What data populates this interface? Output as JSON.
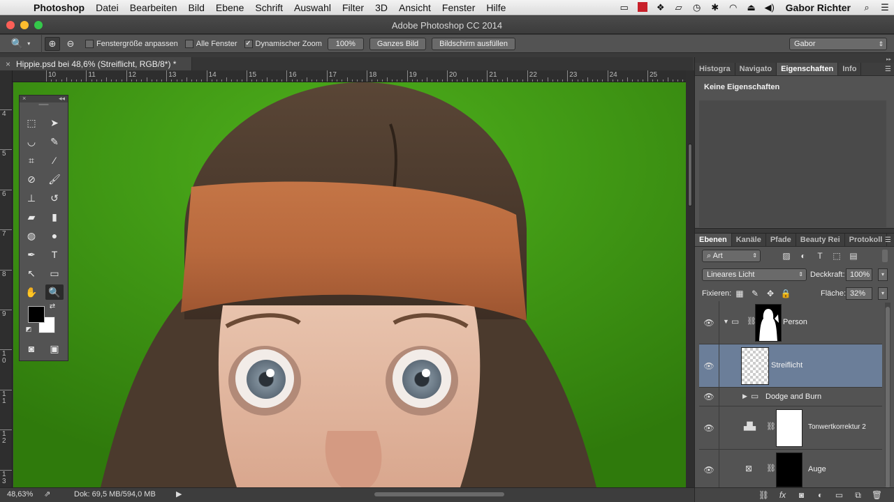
{
  "menubar": {
    "app": "Photoshop",
    "items": [
      "Datei",
      "Bearbeiten",
      "Bild",
      "Ebene",
      "Schrift",
      "Auswahl",
      "Filter",
      "3D",
      "Ansicht",
      "Fenster",
      "Hilfe"
    ],
    "user": "Gabor Richter"
  },
  "window": {
    "title": "Adobe Photoshop CC 2014"
  },
  "options": {
    "fit_window": "Fenstergröße anpassen",
    "all_windows": "Alle Fenster",
    "dynamic_zoom": "Dynamischer Zoom",
    "btn_100": "100%",
    "btn_whole": "Ganzes Bild",
    "btn_fill": "Bildschirm ausfüllen",
    "workspace": "Gabor",
    "fit_window_checked": false,
    "all_windows_checked": false,
    "dynamic_zoom_checked": true
  },
  "document": {
    "tab": "Hippie.psd bei 48,6% (Streiflicht, RGB/8*) *"
  },
  "rulers": {
    "top": [
      "10",
      "11",
      "12",
      "13",
      "14",
      "15",
      "16",
      "17",
      "18",
      "19",
      "20",
      "21",
      "22",
      "23",
      "24",
      "25"
    ],
    "left": [
      "4",
      "5",
      "6",
      "7",
      "8",
      "9",
      "1\n0",
      "1\n1",
      "1\n2",
      "1\n3"
    ]
  },
  "status": {
    "zoom": "48,63%",
    "doc": "Dok: 69,5 MB/594,0 MB"
  },
  "properties": {
    "tabs": [
      "Histogra",
      "Navigato",
      "Eigenschaften",
      "Info"
    ],
    "active_tab": "Eigenschaften",
    "empty_text": "Keine Eigenschaften"
  },
  "layers_panel": {
    "tabs": [
      "Ebenen",
      "Kanäle",
      "Pfade",
      "Beauty Rei",
      "Protokoll"
    ],
    "active_tab": "Ebenen",
    "kind_filter": "Art",
    "blend_mode": "Lineares Licht",
    "opacity_label": "Deckkraft:",
    "opacity": "100%",
    "lock_label": "Fixieren:",
    "fill_label": "Fläche:",
    "fill": "32%",
    "layers": [
      {
        "name": "Person",
        "type": "group",
        "selected": false
      },
      {
        "name": "Streiflicht",
        "type": "layer",
        "selected": true
      },
      {
        "name": "Dodge and Burn",
        "type": "group",
        "selected": false
      },
      {
        "name": "Tonwertkorrektur 2",
        "type": "adjustment",
        "selected": false
      },
      {
        "name": "Auge",
        "type": "layer",
        "selected": false
      }
    ]
  },
  "colors": {
    "background_green": "#3f9a14",
    "headband": "#b8693d",
    "selection": "#6b7e99"
  }
}
